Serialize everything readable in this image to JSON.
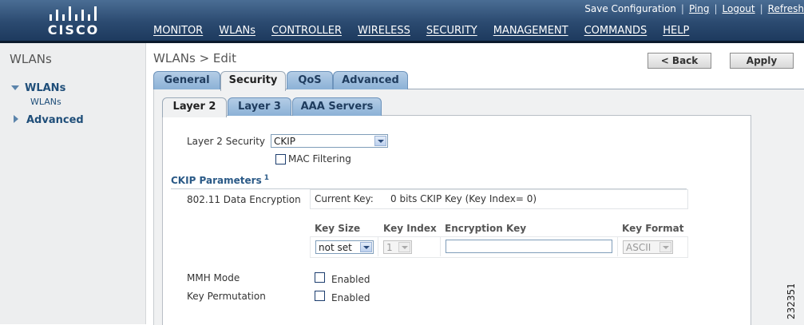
{
  "header": {
    "brand": "CISCO",
    "utility_links": [
      "Save Configuration",
      "Ping",
      "Logout",
      "Refresh"
    ],
    "menu": [
      {
        "label": "MONITOR",
        "active": false
      },
      {
        "label": "WLANs",
        "active": true
      },
      {
        "label": "CONTROLLER",
        "active": false
      },
      {
        "label": "WIRELESS",
        "active": false
      },
      {
        "label": "SECURITY",
        "active": false
      },
      {
        "label": "MANAGEMENT",
        "active": false
      },
      {
        "label": "COMMANDS",
        "active": false
      },
      {
        "label": "HELP",
        "active": false
      }
    ]
  },
  "sidebar": {
    "title": "WLANs",
    "items": [
      {
        "label": "WLANs",
        "expanded": true,
        "children": [
          "WLANs"
        ]
      },
      {
        "label": "Advanced",
        "expanded": false
      }
    ]
  },
  "main": {
    "title": "WLANs > Edit",
    "back_label": "< Back",
    "apply_label": "Apply",
    "tabs": [
      "General",
      "Security",
      "QoS",
      "Advanced"
    ],
    "active_tab": "Security",
    "subtabs": [
      "Layer 2",
      "Layer 3",
      "AAA Servers"
    ],
    "active_subtab": "Layer 2",
    "layer2_security_label": "Layer 2 Security",
    "layer2_security_value": "CKIP",
    "mac_filtering_label": "MAC Filtering",
    "ckip_section_title": "CKIP Parameters",
    "footnote_marker": "1",
    "data_encryption_label": "802.11 Data Encryption",
    "current_key_label": "Current Key:",
    "current_key_value": "0 bits CKIP Key (Key Index= 0)",
    "key_table_headers": [
      "Key Size",
      "Key Index",
      "Encryption Key",
      "Key Format"
    ],
    "key_size_value": "not set",
    "key_index_value": "1",
    "encryption_key_value": "",
    "key_format_value": "ASCII",
    "mmh_mode_label": "MMH Mode",
    "key_permutation_label": "Key Permutation",
    "enabled_label": "Enabled"
  },
  "figure_number": "232351",
  "colors": {
    "header_blue": "#2b4a70",
    "tab_blue": "#8bb1d6",
    "link_blue": "#1f4e79",
    "section_blue": "#2b5a87"
  }
}
